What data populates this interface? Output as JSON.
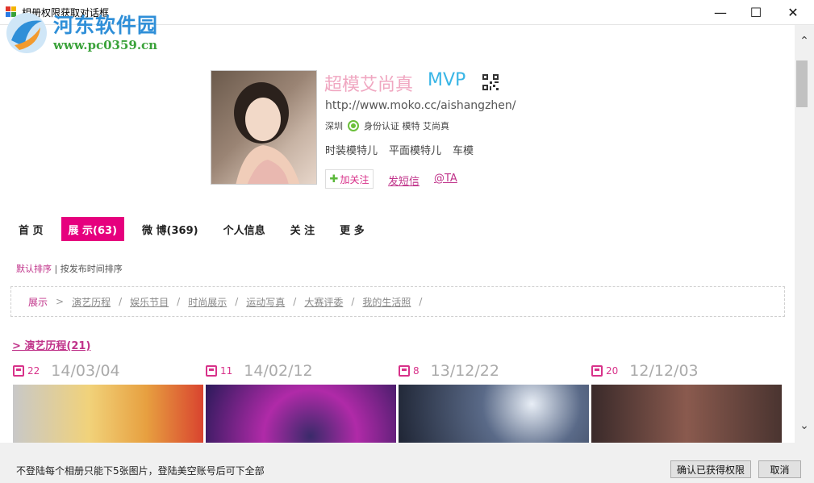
{
  "window": {
    "title": "相册权限获取对话框",
    "minimize": "—",
    "maximize": "☐",
    "close": "✕"
  },
  "watermark": {
    "title": "河东软件园",
    "url": "www.pc0359.cn"
  },
  "profile": {
    "name": "超模艾尚真",
    "badge": "MVP",
    "url": "http://www.moko.cc/aishangzhen/",
    "city": "深圳",
    "verify": "身份认证 模特 艾尚真",
    "tags": [
      "时装模特儿",
      "平面模特儿",
      "车模"
    ],
    "follow": "加关注",
    "message": "发短信",
    "at": "@TA"
  },
  "tabs": [
    "首 页",
    "展 示(63)",
    "微 博(369)",
    "个人信息",
    "关 注",
    "更 多"
  ],
  "sort": {
    "default": "默认排序",
    "sep": " | ",
    "by_time": "按发布时间排序"
  },
  "breadcrumb": {
    "root": "展示",
    "items": [
      "演艺历程",
      "娱乐节目",
      "时尚展示",
      "运动写真",
      "大赛评委",
      "我的生活照"
    ]
  },
  "section": {
    "title": "> 演艺历程(21)"
  },
  "albums": [
    {
      "count": "22",
      "date": "14/03/04"
    },
    {
      "count": "11",
      "date": "14/02/12"
    },
    {
      "count": "8",
      "date": "13/12/22"
    },
    {
      "count": "20",
      "date": "12/12/03"
    }
  ],
  "footer": {
    "notice": "不登陆每个相册只能下5张图片，登陆美空账号后可下全部",
    "confirm": "确认已获得权限",
    "cancel": "取消"
  },
  "colors": {
    "accent": "#e6007e",
    "link": "#c0338a",
    "name": "#f0a7c1",
    "mvp": "#3ab6e6"
  }
}
